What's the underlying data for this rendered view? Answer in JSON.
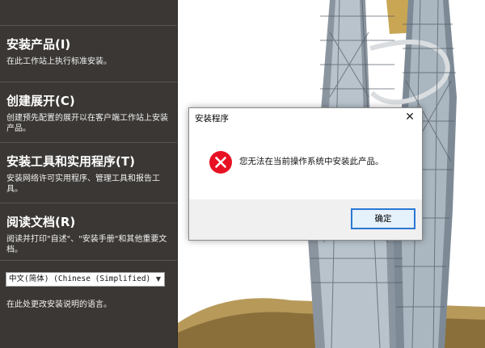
{
  "menu": {
    "items": [
      {
        "title": "安装产品(I)",
        "desc": "在此工作站上执行标准安装。"
      },
      {
        "title": "创建展开(C)",
        "desc": "创建预先配置的展开以在客户端工作站上安装产品。"
      },
      {
        "title": "安装工具和实用程序(T)",
        "desc": "安装网络许可实用程序、管理工具和报告工具。"
      },
      {
        "title": "阅读文档(R)",
        "desc": "阅读并打印\"自述\"、\"安装手册\"和其他重要文档。"
      }
    ],
    "language_select_value": "中文(简体) (Chinese (Simplified)",
    "language_hint": "在此处更改安装说明的语言。"
  },
  "dialog": {
    "title": "安装程序",
    "close_glyph": "✕",
    "message": "您无法在当前操作系统中安装此产品。",
    "ok_label": "确定",
    "icon": "error-icon"
  },
  "colors": {
    "panel_bg": "#3a3734",
    "error_red": "#e81123",
    "ok_border": "#2b78d4"
  }
}
